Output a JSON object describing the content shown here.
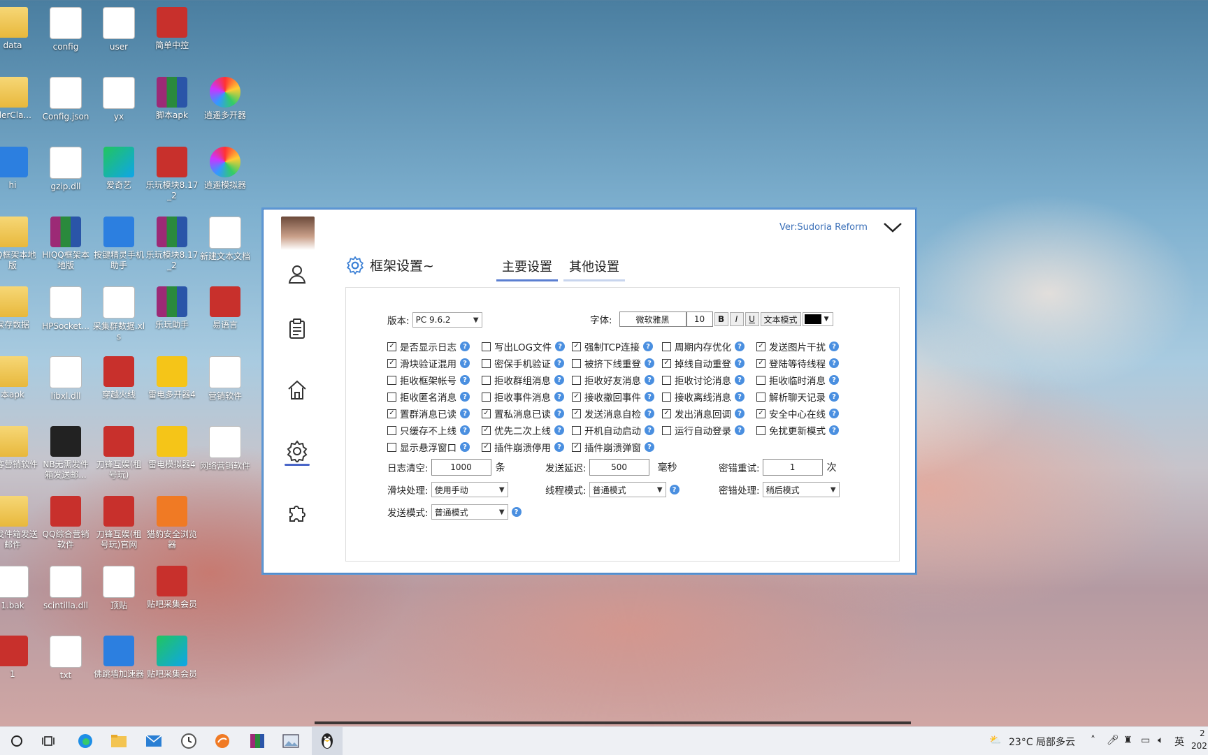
{
  "desktop": {
    "icons": [
      {
        "label": "data",
        "icon": "folder-icon",
        "kind": "folder"
      },
      {
        "label": "config",
        "icon": "settings-file-icon",
        "kind": "gear"
      },
      {
        "label": "user",
        "icon": "settings-file-icon",
        "kind": "gear"
      },
      {
        "label": "简单中控",
        "icon": "app-logo-icon",
        "kind": "red"
      },
      {
        "label": "dlerCla...",
        "icon": "file-icon",
        "kind": "folder"
      },
      {
        "label": "Config.json",
        "icon": "document-icon",
        "kind": "doc"
      },
      {
        "label": "yx",
        "icon": "text-file-icon",
        "kind": "doc"
      },
      {
        "label": "脚本apk",
        "icon": "archive-icon",
        "kind": "rar"
      },
      {
        "label": "逍遥多开器",
        "icon": "multi-open-icon",
        "kind": "color"
      },
      {
        "label": "hi",
        "icon": "image-file-icon",
        "kind": "blue"
      },
      {
        "label": "gzip.dll",
        "icon": "dll-file-icon",
        "kind": "gear"
      },
      {
        "label": "爱奇艺",
        "icon": "iqiyi-icon",
        "kind": "green"
      },
      {
        "label": "乐玩模块8.17_2",
        "icon": "ec-icon",
        "kind": "red"
      },
      {
        "label": "逍遥模拟器",
        "icon": "emulator-icon",
        "kind": "color"
      },
      {
        "label": "QQ框架本地版",
        "icon": "folder-icon",
        "kind": "folder"
      },
      {
        "label": "HIQQ框架本地版",
        "icon": "archive-icon",
        "kind": "rar"
      },
      {
        "label": "按键精灵手机助手",
        "icon": "robot-icon",
        "kind": "blue"
      },
      {
        "label": "乐玩模块8.17_2",
        "icon": "archive-icon",
        "kind": "rar"
      },
      {
        "label": "新建文本文档",
        "icon": "text-file-icon",
        "kind": "doc"
      },
      {
        "label": "保存数据",
        "icon": "folder-icon",
        "kind": "folder"
      },
      {
        "label": "HPSocket...",
        "icon": "dll-file-icon",
        "kind": "gear"
      },
      {
        "label": "采集群数据.xls",
        "icon": "document-icon",
        "kind": "doc"
      },
      {
        "label": "乐玩助手",
        "icon": "archive-icon",
        "kind": "rar"
      },
      {
        "label": "易语言",
        "icon": "app-logo-icon",
        "kind": "red"
      },
      {
        "label": "本apk",
        "icon": "apk-icon",
        "kind": "folder"
      },
      {
        "label": "libxl.dll",
        "icon": "dll-file-icon",
        "kind": "gear"
      },
      {
        "label": "穿越火线",
        "icon": "cf-icon",
        "kind": "red"
      },
      {
        "label": "雷电多开器4",
        "icon": "multi-open-icon",
        "kind": "yellow"
      },
      {
        "label": "营销软件",
        "icon": "text-file-icon",
        "kind": "doc"
      },
      {
        "label": "创客营销软件",
        "icon": "folder-icon",
        "kind": "folder"
      },
      {
        "label": "NB无需发件箱发送邮...",
        "icon": "nb-icon",
        "kind": "dark"
      },
      {
        "label": "刀锋互娱(租号玩)",
        "icon": "lion-icon",
        "kind": "red"
      },
      {
        "label": "雷电模拟器4",
        "icon": "emulator-icon",
        "kind": "yellow"
      },
      {
        "label": "网络营销软件",
        "icon": "text-file-icon",
        "kind": "doc"
      },
      {
        "label": "需发件箱发送邮件",
        "icon": "folder-icon",
        "kind": "folder"
      },
      {
        "label": "QQ综合营销软件",
        "icon": "app-icon",
        "kind": "red"
      },
      {
        "label": "刀锋互娱(租号玩)官网",
        "icon": "lion-icon",
        "kind": "red"
      },
      {
        "label": "猎豹安全浏览器",
        "icon": "browser-icon",
        "kind": "orange"
      },
      {
        "label": "1.bak",
        "icon": "file-icon",
        "kind": "doc"
      },
      {
        "label": "scintilla.dll",
        "icon": "dll-file-icon",
        "kind": "gear"
      },
      {
        "label": "顶贴",
        "icon": "text-file-icon",
        "kind": "doc"
      },
      {
        "label": "贴吧采集会员",
        "icon": "app-logo-icon",
        "kind": "red"
      },
      {
        "label": "1",
        "icon": "app-logo-icon",
        "kind": "red"
      },
      {
        "label": "txt",
        "icon": "settings-file-icon",
        "kind": "gear"
      },
      {
        "label": "佛跳墙加速器",
        "icon": "accelerator-icon",
        "kind": "blue"
      },
      {
        "label": "贴吧采集会员",
        "icon": "stripe-icon",
        "kind": "green"
      }
    ]
  },
  "window": {
    "version": "Ver:Sudoria Reform",
    "title": "框架设置~",
    "tabs": [
      "主要设置",
      "其他设置"
    ],
    "version_label": "版本:",
    "version_select": "PC  9.6.2",
    "font_label": "字体:",
    "font_name": "微软雅黑",
    "font_size": "10",
    "bold": "B",
    "italic": "I",
    "underline": "U",
    "text_mode": "文本模式",
    "font_color": "#000000",
    "checkboxes": [
      {
        "label": "是否显示日志",
        "checked": true
      },
      {
        "label": "写出LOG文件",
        "checked": false
      },
      {
        "label": "强制TCP连接",
        "checked": true
      },
      {
        "label": "周期内存优化",
        "checked": false
      },
      {
        "label": "发送图片干扰",
        "checked": true
      },
      {
        "label": "滑块验证混用",
        "checked": true
      },
      {
        "label": "密保手机验证",
        "checked": false
      },
      {
        "label": "被挤下线重登",
        "checked": false
      },
      {
        "label": "掉线自动重登",
        "checked": true
      },
      {
        "label": "登陆等待线程",
        "checked": true
      },
      {
        "label": "拒收框架帐号",
        "checked": false
      },
      {
        "label": "拒收群组消息",
        "checked": false
      },
      {
        "label": "拒收好友消息",
        "checked": false
      },
      {
        "label": "拒收讨论消息",
        "checked": false
      },
      {
        "label": "拒收临时消息",
        "checked": false
      },
      {
        "label": "拒收匿名消息",
        "checked": false
      },
      {
        "label": "拒收事件消息",
        "checked": false
      },
      {
        "label": "接收撤回事件",
        "checked": true
      },
      {
        "label": "接收离线消息",
        "checked": false
      },
      {
        "label": "解析聊天记录",
        "checked": false
      },
      {
        "label": "置群消息已读",
        "checked": true
      },
      {
        "label": "置私消息已读",
        "checked": true
      },
      {
        "label": "发送消息自检",
        "checked": true
      },
      {
        "label": "发出消息回调",
        "checked": true
      },
      {
        "label": "安全中心在线",
        "checked": true
      },
      {
        "label": "只缓存不上线",
        "checked": false
      },
      {
        "label": "优先二次上线",
        "checked": true
      },
      {
        "label": "开机自动启动",
        "checked": false
      },
      {
        "label": "运行自动登录",
        "checked": false
      },
      {
        "label": "免扰更新模式",
        "checked": false
      },
      {
        "label": "显示悬浮窗口",
        "checked": false
      },
      {
        "label": "插件崩溃停用",
        "checked": true
      },
      {
        "label": "插件崩溃弹窗",
        "checked": true
      }
    ],
    "log_clear_label": "日志清空:",
    "log_clear_value": "1000",
    "log_clear_unit": "条",
    "send_delay_label": "发送延迟:",
    "send_delay_value": "500",
    "send_delay_unit": "毫秒",
    "pwd_retry_label": "密错重试:",
    "pwd_retry_value": "1",
    "pwd_retry_unit": "次",
    "slider_label": "滑块处理:",
    "slider_value": "使用手动",
    "thread_label": "线程模式:",
    "thread_value": "普通模式",
    "pwd_handle_label": "密错处理:",
    "pwd_handle_value": "稍后模式",
    "send_mode_label": "发送模式:",
    "send_mode_value": "普通模式",
    "help": "?"
  },
  "taskbar": {
    "weather": "23°C  局部多云",
    "ime": "英",
    "clock_top": "2",
    "clock_bottom": "202"
  },
  "colors": {
    "accent": "#4a66c8",
    "window_border": "#3f7cc0",
    "help_icon": "#4a8fe0"
  }
}
